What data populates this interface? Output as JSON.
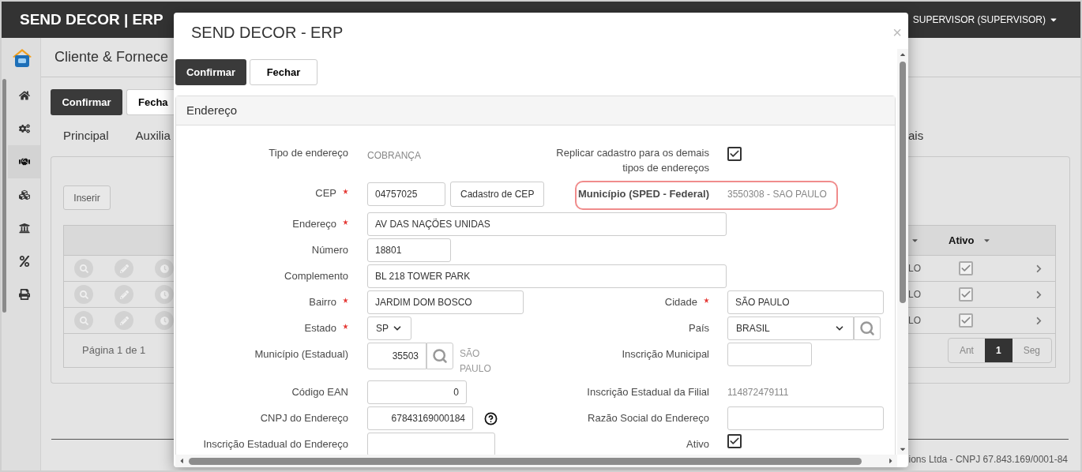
{
  "app": {
    "brand": "SEND DECOR | ERP",
    "user": "SUPERVISOR (SUPERVISOR)"
  },
  "sidebar": {
    "items": [
      {
        "kind": "home",
        "selected": false
      },
      {
        "kind": "settings",
        "selected": false
      },
      {
        "kind": "partners",
        "selected": true
      },
      {
        "kind": "products",
        "selected": false
      },
      {
        "kind": "bank",
        "selected": false
      },
      {
        "kind": "tax",
        "selected": false
      },
      {
        "kind": "print",
        "selected": false
      }
    ]
  },
  "page": {
    "title": "Cliente & Fornece",
    "buttons": [
      {
        "label": "Confirmar",
        "kind": "primary"
      },
      {
        "label": "Fecha",
        "kind": "default"
      }
    ],
    "tabs_left": [
      {
        "label": "Principal",
        "selected": false
      },
      {
        "label": "Auxilia",
        "selected": false
      }
    ],
    "tabs_right": [
      {
        "label": "ais",
        "selected": false
      }
    ],
    "insert_button": "Inserir",
    "table": {
      "columns": [
        {
          "label": "Ativo"
        }
      ],
      "rows": [
        {
          "column_1": "LO",
          "active": true
        },
        {
          "column_1": "LO",
          "active": true
        },
        {
          "column_1": "LO",
          "active": true
        }
      ],
      "summary": "Página 1 de 1",
      "pages": [
        {
          "label": "Ant",
          "selected": false
        },
        {
          "label": "1",
          "selected": true
        },
        {
          "label": "Seg",
          "selected": false
        }
      ]
    },
    "footer": "ions Ltda - CNPJ 67.843.169/0001-84"
  },
  "modal": {
    "title": "SEND DECOR - ERP",
    "close": "×",
    "buttons": [
      {
        "label": "Confirmar",
        "kind": "primary"
      },
      {
        "label": "Fechar",
        "kind": "default"
      }
    ],
    "section": "Endereço",
    "rows": [
      {
        "left": {
          "label": "Tipo de endereço",
          "kind": "text",
          "value": "COBRANÇA"
        },
        "right": {
          "label": "Replicar cadastro para os demais tipos de endereços",
          "kind": "checkbox",
          "checked": true
        }
      },
      {
        "left": {
          "label": "CEP",
          "required": true,
          "kind": "input",
          "value": "04757025",
          "button": "Cadastro de CEP"
        },
        "right": {
          "label": "Município (SPED - Federal)",
          "kind": "text",
          "value": "3550308 - SAO PAULO",
          "highlighted": true
        }
      },
      {
        "left": {
          "label": "Endereço",
          "required": true,
          "kind": "input",
          "value": "AV DAS NAÇÕES UNIDAS"
        }
      },
      {
        "left": {
          "label": "Número",
          "kind": "input",
          "value": "18801"
        }
      },
      {
        "left": {
          "label": "Complemento",
          "kind": "input",
          "value": "BL 218 TOWER PARK"
        }
      },
      {
        "left": {
          "label": "Bairro",
          "required": true,
          "kind": "input",
          "value": "JARDIM DOM BOSCO"
        },
        "right": {
          "label": "Cidade",
          "required": true,
          "kind": "input",
          "value": "SÃO PAULO"
        }
      },
      {
        "left": {
          "label": "Estado",
          "required": true,
          "kind": "select",
          "value": "SP"
        },
        "right": {
          "label": "País",
          "kind": "select",
          "value": "BRASIL",
          "search": true
        }
      },
      {
        "left": {
          "label": "Município (Estadual)",
          "kind": "lookup",
          "value": "35503",
          "note": "SÃO PAULO"
        },
        "right": {
          "label": "Inscrição Municipal",
          "kind": "input"
        }
      },
      {
        "left": {
          "label": "Código EAN",
          "kind": "input",
          "value": "0"
        },
        "right": {
          "label": "Inscrição Estadual da Filial",
          "kind": "text",
          "value": "114872479111"
        }
      },
      {
        "left": {
          "label": "CNPJ do Endereço",
          "kind": "input",
          "value": "67843169000184",
          "help": true
        },
        "right": {
          "label": "Razão Social do Endereço",
          "kind": "input"
        }
      },
      {
        "left": {
          "label": "Inscrição Estadual do Endereço",
          "kind": "input"
        },
        "right": {
          "label": "Ativo",
          "kind": "checkbox",
          "checked": true
        }
      }
    ]
  }
}
